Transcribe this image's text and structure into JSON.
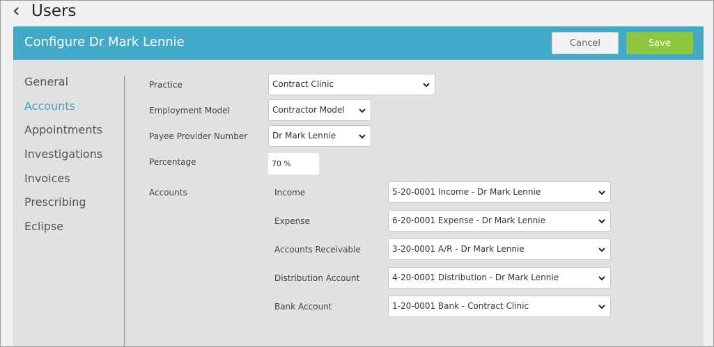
{
  "page": {
    "title": "Users"
  },
  "header": {
    "title": "Configure Dr Mark Lennie",
    "cancel_label": "Cancel",
    "save_label": "Save"
  },
  "nav": {
    "items": [
      {
        "label": "General",
        "active": false
      },
      {
        "label": "Accounts",
        "active": true
      },
      {
        "label": "Appointments",
        "active": false
      },
      {
        "label": "Investigations",
        "active": false
      },
      {
        "label": "Invoices",
        "active": false
      },
      {
        "label": "Prescribing",
        "active": false
      },
      {
        "label": "Eclipse",
        "active": false
      }
    ]
  },
  "form": {
    "practice": {
      "label": "Practice",
      "value": "Contract Clinic"
    },
    "employment_model": {
      "label": "Employment Model",
      "value": "Contractor Model"
    },
    "payee_provider": {
      "label": "Payee Provider Number",
      "value": "Dr Mark Lennie"
    },
    "percentage": {
      "label": "Percentage",
      "value": "70 %"
    },
    "accounts": {
      "label": "Accounts",
      "income": {
        "label": "Income",
        "value": "5-20-0001 Income - Dr Mark Lennie"
      },
      "expense": {
        "label": "Expense",
        "value": "6-20-0001 Expense - Dr Mark Lennie"
      },
      "receivable": {
        "label": "Accounts Receivable",
        "value": "3-20-0001 A/R - Dr Mark Lennie"
      },
      "distribution": {
        "label": "Distribution Account",
        "value": "4-20-0001 Distribution - Dr Mark Lennie"
      },
      "bank": {
        "label": "Bank Account",
        "value": "1-20-0001 Bank - Contract Clinic"
      }
    }
  },
  "colors": {
    "header_bg": "#42a9c9",
    "save_bg": "#8dc63f",
    "active_nav": "#3fa2c4"
  },
  "icons": {
    "back": "chevron-left-icon",
    "dropdown": "chevron-down-icon"
  }
}
